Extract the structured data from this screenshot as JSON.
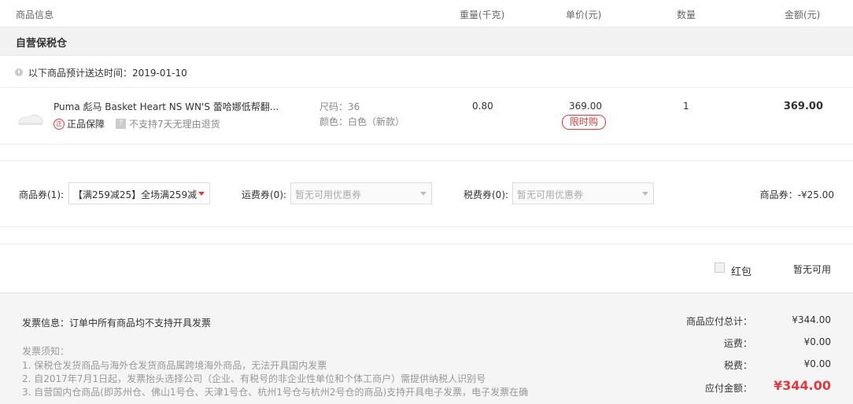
{
  "header": {
    "col_product": "商品信息",
    "col_weight": "重量(千克)",
    "col_price": "单价(元)",
    "col_qty": "数量",
    "col_amount": "金额(元)"
  },
  "warehouse": {
    "name": "自营保税仓"
  },
  "delivery": {
    "text": "以下商品预计送达时间：2019-01-10"
  },
  "item": {
    "title": "Puma 彪马 Basket Heart NS WN'S 蕾哈娜低帮翻...",
    "guarantee": "正品保障",
    "no_return": "不支持7天无理由退货",
    "size": "尺码：36",
    "color": "颜色：白色（新款）",
    "weight": "0.80",
    "price": "369.00",
    "tag": "限时购",
    "qty": "1",
    "amount": "369.00"
  },
  "coupons": {
    "product_label": "商品券(1):",
    "product_value": "【满259减25】全场满259减...",
    "shipping_label": "运费券(0):",
    "shipping_value": "暂无可用优惠券",
    "tax_label": "税费券(0):",
    "tax_value": "暂无可用优惠券",
    "discount": "商品券：-¥25.00"
  },
  "redpacket": {
    "label": "红包",
    "status": "暂无可用"
  },
  "invoice": {
    "info": "发票信息：订单中所有商品均不支持开具发票",
    "notes_title": "发票须知：",
    "notes": [
      "1. 保税仓发货商品与海外仓发货商品属跨境海外商品，无法开具国内发票",
      "2. 自2017年7月1日起，发票抬头选择公司（企业、有税号的非企业性单位和个体工商户）需提供纳税人识别号",
      "3. 自营国内仓商品(即苏州仓、佛山1号仓、天津1号仓、杭州1号仓与杭州2号仓的商品)支持开具电子发票，电子发票在确"
    ]
  },
  "summary": {
    "subtotal_label": "商品应付总计：",
    "subtotal": "¥344.00",
    "shipping_label": "运费：",
    "shipping": "¥0.00",
    "tax_label": "税费：",
    "tax": "¥0.00",
    "total_label": "应付金额：",
    "total": "¥344.00"
  },
  "colors": {
    "accent": "#e4393c"
  }
}
